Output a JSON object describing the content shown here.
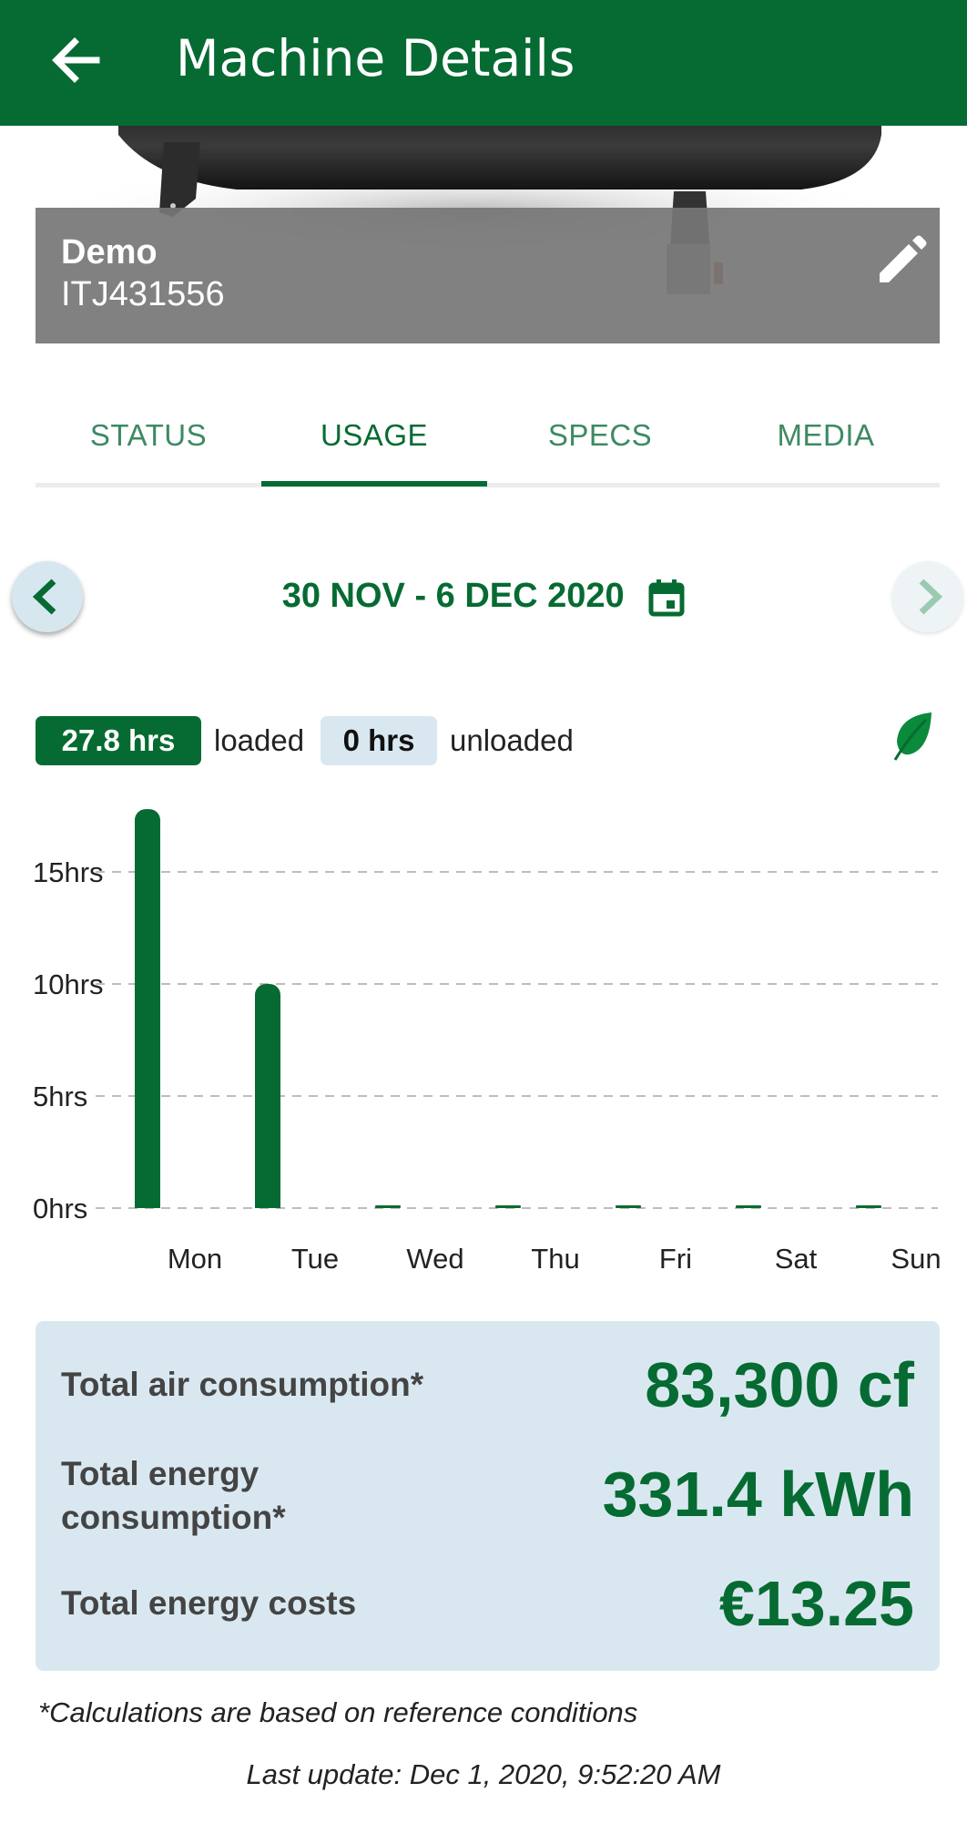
{
  "appbar": {
    "title": "Machine Details",
    "back_icon": "arrow-left-icon"
  },
  "machine": {
    "name": "Demo",
    "serial": "ITJ431556",
    "edit_icon": "pencil-icon"
  },
  "tabs": [
    {
      "label": "STATUS",
      "active": false
    },
    {
      "label": "USAGE",
      "active": true
    },
    {
      "label": "SPECS",
      "active": false
    },
    {
      "label": "MEDIA",
      "active": false
    }
  ],
  "period": {
    "label": "30 NOV - 6 DEC 2020",
    "calendar_icon": "calendar-icon"
  },
  "usage": {
    "loaded_value": "27.8 hrs",
    "loaded_label": "loaded",
    "unloaded_value": "0 hrs",
    "unloaded_label": "unloaded",
    "eco_icon": "leaf-icon"
  },
  "chart_data": {
    "type": "bar",
    "categories": [
      "Mon",
      "Tue",
      "Wed",
      "Thu",
      "Fri",
      "Sat",
      "Sun"
    ],
    "values": [
      17.8,
      10.0,
      0,
      0,
      0,
      0,
      0
    ],
    "yticks": [
      "0hrs",
      "5hrs",
      "10hrs",
      "15hrs"
    ],
    "ytick_values": [
      0,
      5,
      10,
      15
    ],
    "ylim": [
      0,
      18
    ],
    "grid": true,
    "bar_color": "#066b32"
  },
  "summary": {
    "air_label": "Total air consumption*",
    "air_value": "83,300 cf",
    "energy_label_line1": "Total energy",
    "energy_label_line2": "consumption*",
    "energy_value": "331.4 kWh",
    "cost_label": "Total energy costs",
    "cost_value": "€13.25"
  },
  "footnote": "*Calculations are based on reference conditions",
  "last_update": "Last update: Dec 1, 2020, 9:52:20 AM",
  "colors": {
    "brand": "#066b32",
    "panel": "#d9e8f0"
  }
}
